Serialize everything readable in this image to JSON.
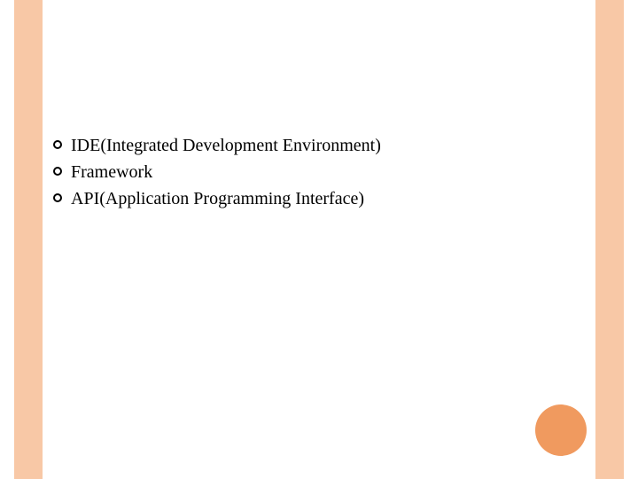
{
  "bullets": {
    "items": [
      {
        "text": "IDE(Integrated Development Environment)"
      },
      {
        "text": "Framework"
      },
      {
        "text": "API(Application Programming  Interface)"
      }
    ]
  },
  "colors": {
    "band": "#f8c8a6",
    "circle": "#f09a5f"
  }
}
